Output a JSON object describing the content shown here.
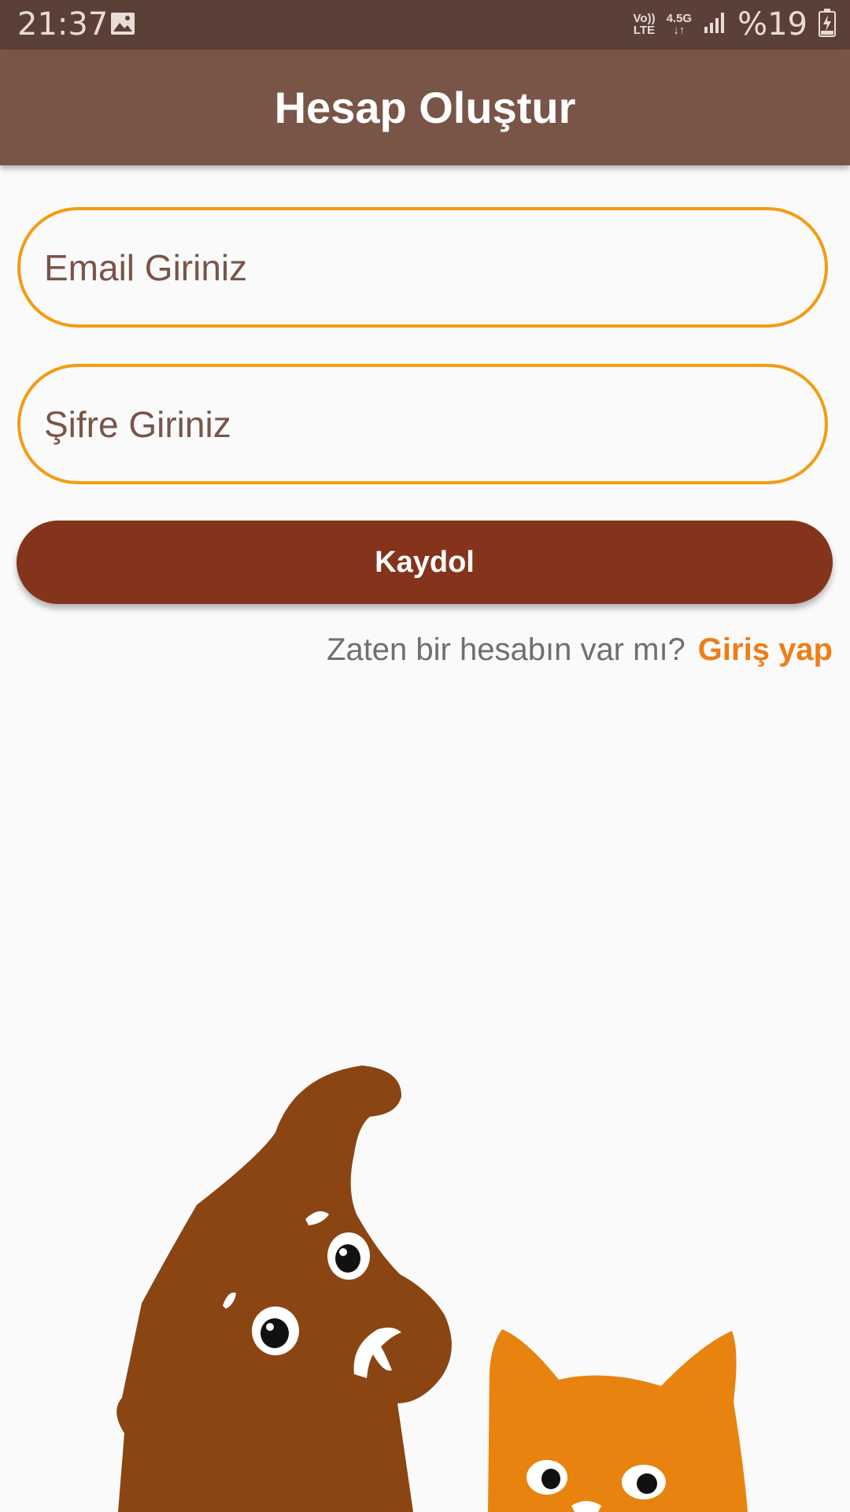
{
  "status_bar": {
    "time": "21:37",
    "volte_top": "Vo))",
    "volte_bottom": "LTE",
    "network": "4.5G",
    "battery": "%19",
    "icons": [
      "image-icon",
      "volte-icon",
      "network-icon",
      "signal-icon",
      "battery-charging-icon"
    ]
  },
  "app_bar": {
    "title": "Hesap Oluştur"
  },
  "form": {
    "email_placeholder": "Email Giriniz",
    "password_placeholder": "Şifre Giriniz",
    "register_label": "Kaydol",
    "login_question": "Zaten bir hesabın var mı?",
    "login_link": "Giriş yap"
  },
  "illustration": {
    "name": "dog-and-cat",
    "colors": {
      "dog": "#8a4513",
      "cat": "#e8830f"
    }
  },
  "colors": {
    "status_bar": "#5b4038",
    "app_bar": "#795548",
    "field_border": "#f39c12",
    "button": "#84341b",
    "link": "#ef7d17",
    "background": "#fafafa"
  }
}
